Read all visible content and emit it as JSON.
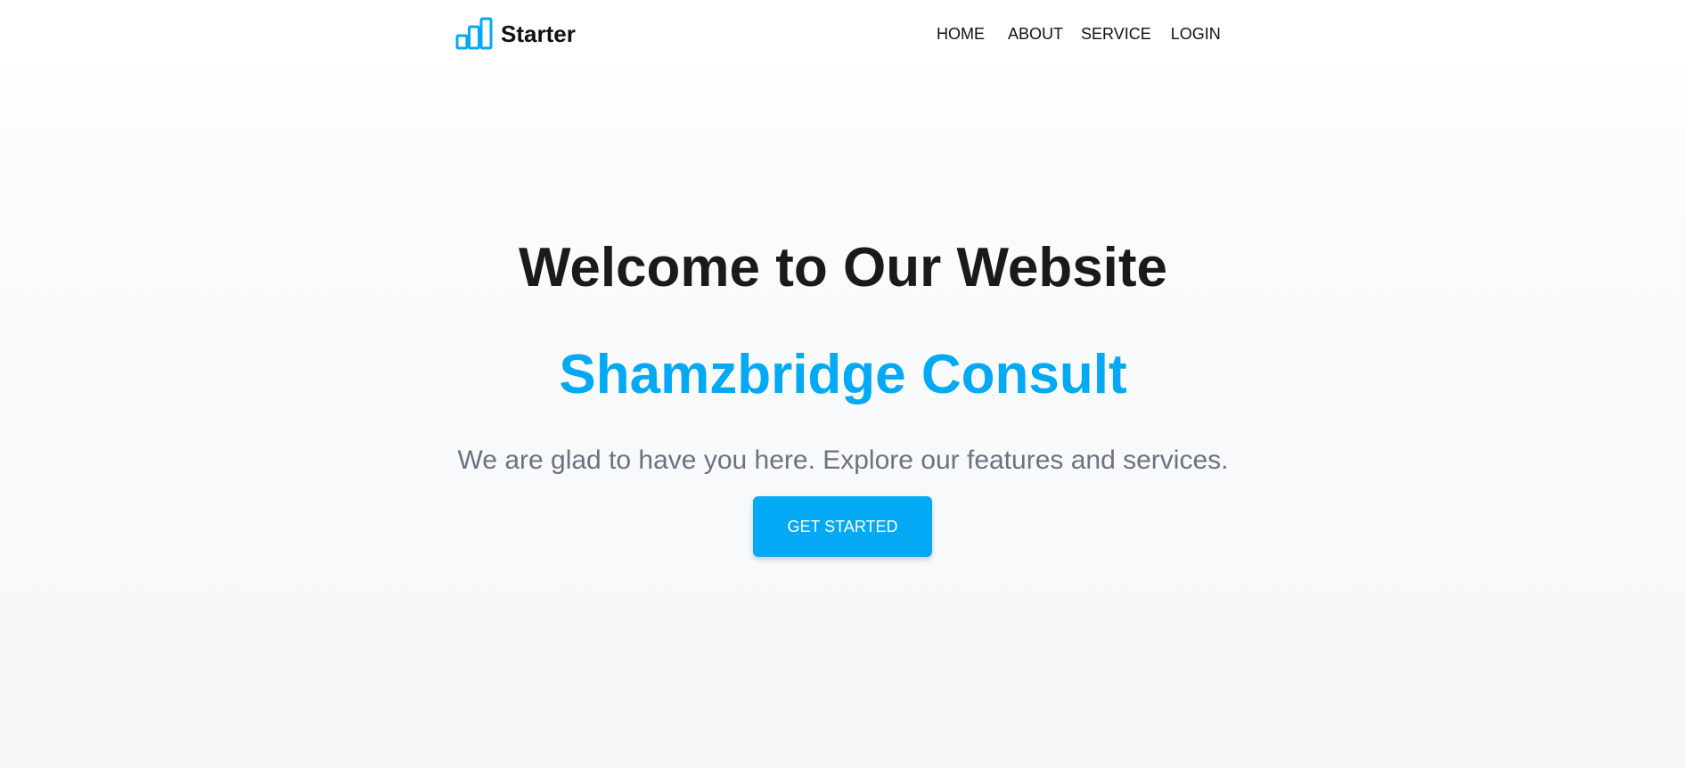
{
  "header": {
    "brand_name": "Starter",
    "brand_icon": "bar-chart-icon",
    "nav": [
      {
        "label": "HOME"
      },
      {
        "label": "ABOUT"
      },
      {
        "label": "SERVICE"
      },
      {
        "label": "LOGIN"
      }
    ]
  },
  "hero": {
    "title": "Welcome to Our Website",
    "company": "Shamzbridge Consult",
    "subtitle": "We are glad to have you here. Explore our features and services.",
    "cta_label": "GET STARTED"
  },
  "colors": {
    "accent": "#03a9f4",
    "title": "#1a1a1a",
    "subtitle": "#6b7280",
    "background": "#f8f9fb"
  }
}
